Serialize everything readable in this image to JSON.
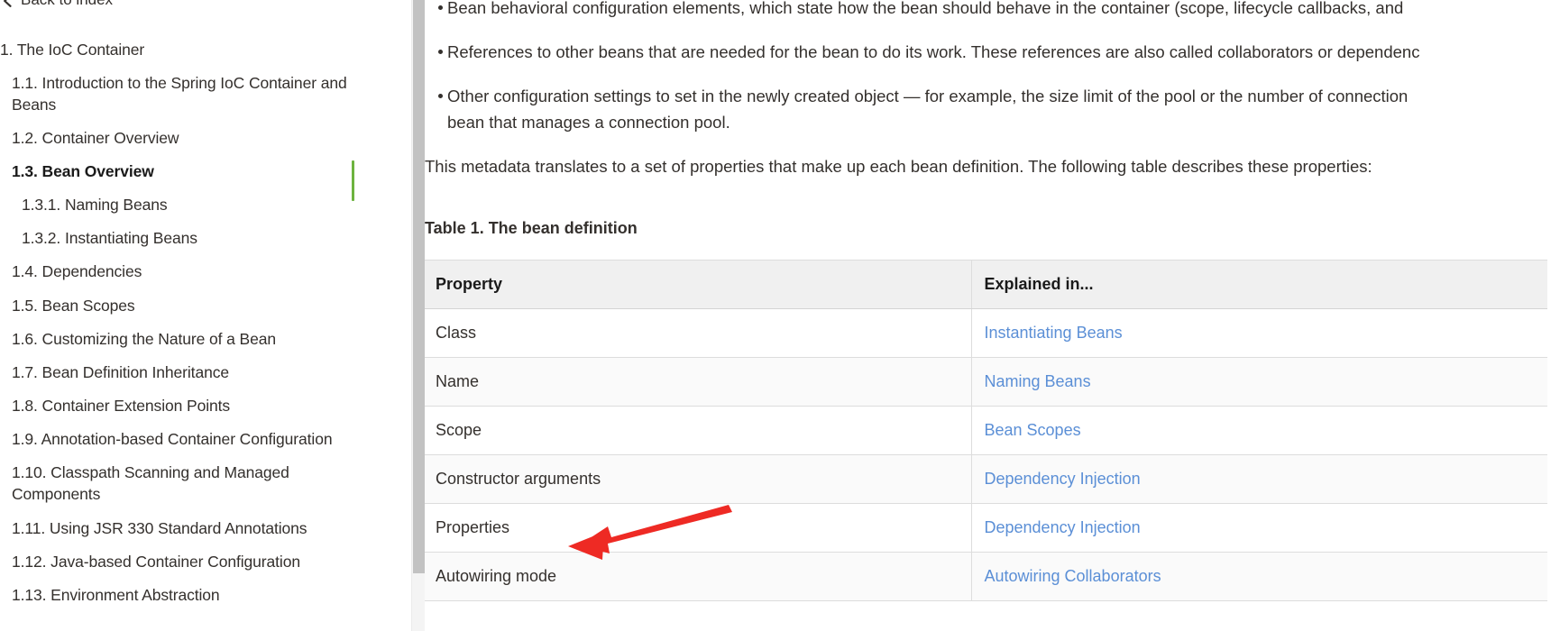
{
  "sidebar": {
    "back_link": {
      "label": "Back to index",
      "icon": "chevron-left-icon"
    },
    "items": [
      {
        "label": "1. The IoC Container",
        "level": 1,
        "active": false
      },
      {
        "label": "1.1. Introduction to the Spring IoC Container and Beans",
        "level": 2,
        "active": false
      },
      {
        "label": "1.2. Container Overview",
        "level": 2,
        "active": false
      },
      {
        "label": "1.3. Bean Overview",
        "level": 2,
        "active": true
      },
      {
        "label": "1.3.1. Naming Beans",
        "level": 3,
        "active": false
      },
      {
        "label": "1.3.2. Instantiating Beans",
        "level": 3,
        "active": false
      },
      {
        "label": "1.4. Dependencies",
        "level": 2,
        "active": false
      },
      {
        "label": "1.5. Bean Scopes",
        "level": 2,
        "active": false
      },
      {
        "label": "1.6. Customizing the Nature of a Bean",
        "level": 2,
        "active": false
      },
      {
        "label": "1.7. Bean Definition Inheritance",
        "level": 2,
        "active": false
      },
      {
        "label": "1.8. Container Extension Points",
        "level": 2,
        "active": false
      },
      {
        "label": "1.9. Annotation-based Container Configuration",
        "level": 2,
        "active": false
      },
      {
        "label": "1.10. Classpath Scanning and Managed Components",
        "level": 2,
        "active": false
      },
      {
        "label": "1.11. Using JSR 330 Standard Annotations",
        "level": 2,
        "active": false
      },
      {
        "label": "1.12. Java-based Container Configuration",
        "level": 2,
        "active": false
      },
      {
        "label": "1.13. Environment Abstraction",
        "level": 2,
        "active": false
      }
    ],
    "active_accent_color": "#6db33f"
  },
  "main": {
    "bullets": [
      "Bean behavioral configuration elements, which state how the bean should behave in the container (scope, lifecycle callbacks, and",
      "References to other beans that are needed for the bean to do its work. These references are also called collaborators or dependenc",
      "Other configuration settings to set in the newly created object — for example, the size limit of the pool or the number of connection bean that manages a connection pool."
    ],
    "bullet3_line1": "Other configuration settings to set in the newly created object — for example, the size limit of the pool or the number of connection",
    "bullet3_line2": "bean that manages a connection pool.",
    "paragraph": "This metadata translates to a set of properties that make up each bean definition. The following table describes these properties:",
    "table_caption": "Table 1. The bean definition",
    "table": {
      "headers": [
        "Property",
        "Explained in..."
      ],
      "rows": [
        {
          "property": "Class",
          "explained_in": "Instantiating Beans"
        },
        {
          "property": "Name",
          "explained_in": "Naming Beans"
        },
        {
          "property": "Scope",
          "explained_in": "Bean Scopes"
        },
        {
          "property": "Constructor arguments",
          "explained_in": "Dependency Injection"
        },
        {
          "property": "Properties",
          "explained_in": "Dependency Injection"
        },
        {
          "property": "Autowiring mode",
          "explained_in": "Autowiring Collaborators"
        }
      ]
    },
    "link_color": "#5b8fd6"
  },
  "annotation": {
    "type": "red-arrow",
    "color": "#ee2a24",
    "points_to": "Autowiring mode"
  }
}
